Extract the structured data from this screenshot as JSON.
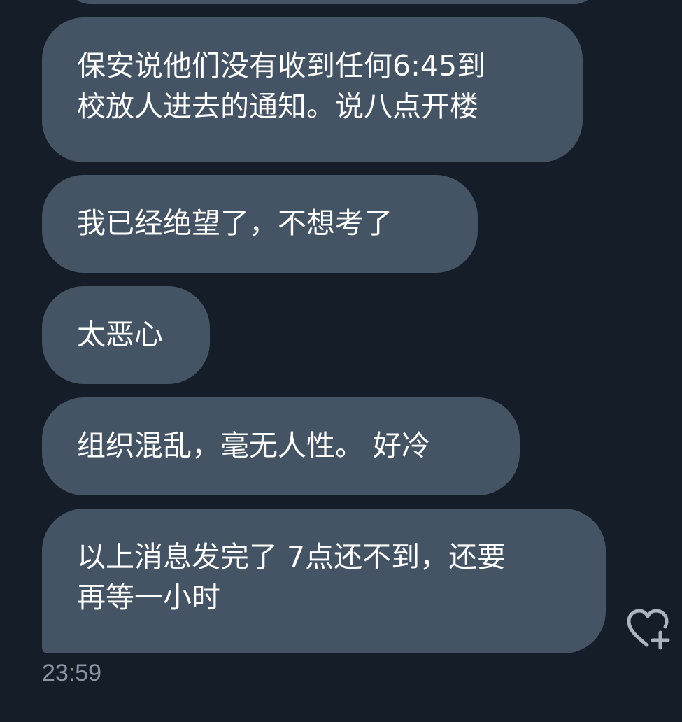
{
  "messages": [
    {
      "lines": [
        "保安说他们没有收到任何6:45到",
        "校放人进去的通知。说八点开楼"
      ]
    },
    {
      "lines": [
        "我已经绝望了，不想考了"
      ]
    },
    {
      "lines": [
        "太恶心"
      ]
    },
    {
      "lines": [
        "组织混乱，毫无人性。 好冷"
      ]
    },
    {
      "lines": [
        "以上消息发完了 7点还不到，还要",
        "再等一小时"
      ]
    }
  ],
  "timestamp": "23:59",
  "react_icon": "heart-plus-icon",
  "colors": {
    "background": "#151d28",
    "bubble": "#455464",
    "text": "#ffffff",
    "timestamp": "#8a96a3",
    "icon": "#aab4bf"
  }
}
